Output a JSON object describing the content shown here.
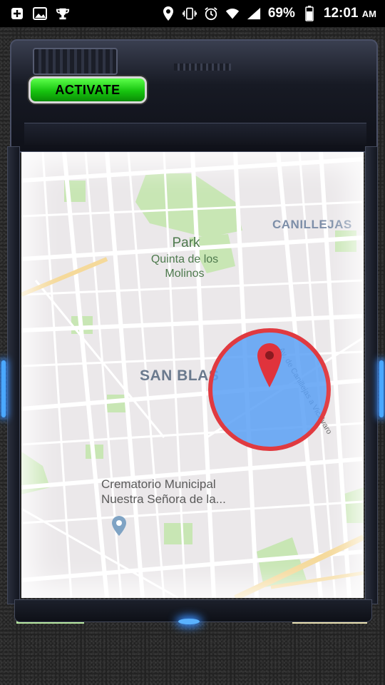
{
  "status_bar": {
    "battery": "69%",
    "time": "12:01",
    "ampm": "AM",
    "icons": [
      "plus-box-icon",
      "image-icon",
      "trophy-icon",
      "location-icon",
      "vibrate-icon",
      "alarm-icon",
      "wifi-icon",
      "signal-icon",
      "battery-icon"
    ]
  },
  "panel": {
    "activate_label": "ACTIVATE",
    "accent_color": "#17c40f",
    "glow_color": "#3a8fff"
  },
  "map": {
    "labels": {
      "park": "Park",
      "quinta": "Quinta de los Molinos",
      "canillejas": "CANILLEJAS",
      "san_blas": "SAN BLAS",
      "crematorio": "Crematorio Municipal Nuestra Señora de la...",
      "avenue": "Av. de Canillejas a Vicálvaro"
    },
    "target_circle_color": "#e03a40",
    "target_fill_color": "#5aa0f5"
  }
}
